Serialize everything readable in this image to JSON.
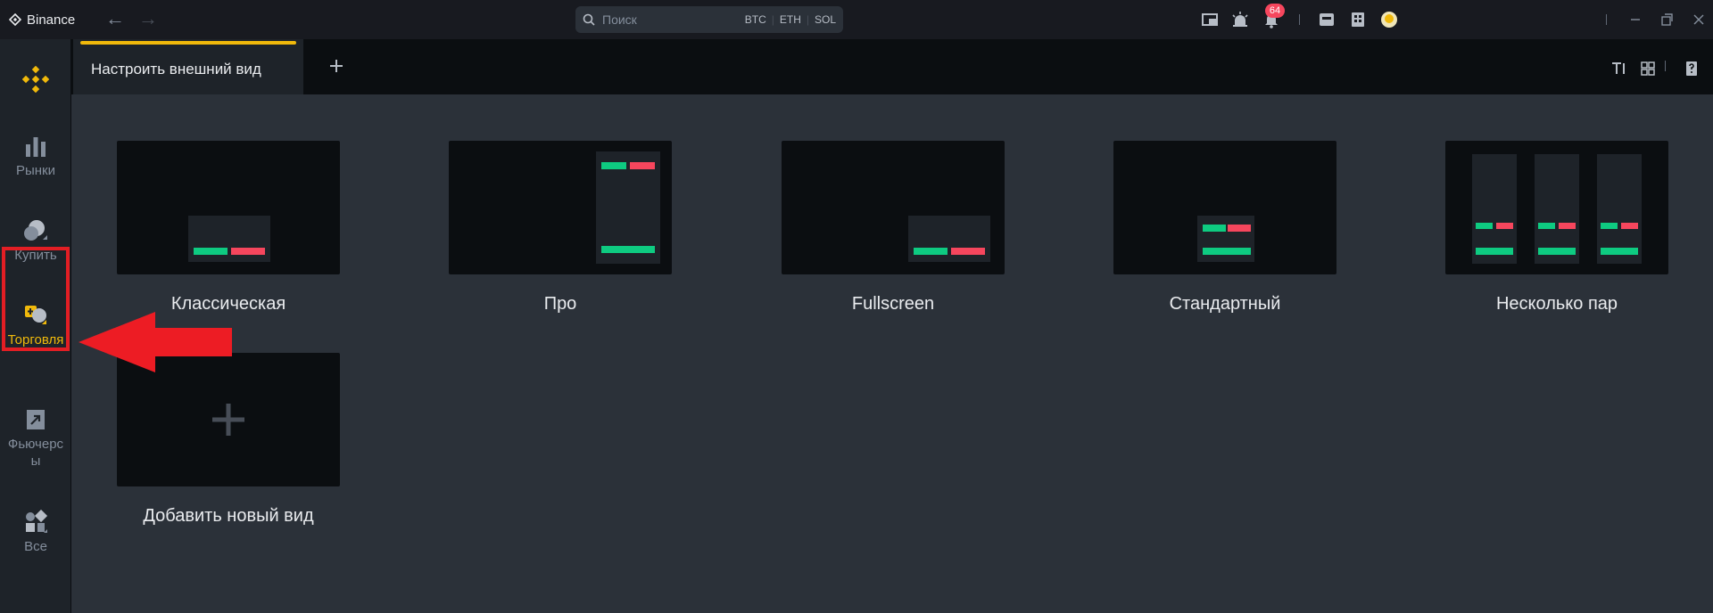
{
  "app": {
    "title": "Binance"
  },
  "search": {
    "placeholder": "Поиск",
    "chips": [
      "BTC",
      "ETH",
      "SOL"
    ]
  },
  "notifications": {
    "count": "64"
  },
  "sidebar": {
    "items": [
      {
        "label": "Рынки",
        "icon": "markets-icon"
      },
      {
        "label": "Купить",
        "icon": "buy-crypto-icon"
      },
      {
        "label": "Торговля",
        "icon": "trade-icon",
        "active": true
      },
      {
        "label": "Фьючерсы",
        "icon": "futures-icon"
      },
      {
        "label": "Все",
        "icon": "all-apps-icon"
      }
    ]
  },
  "tabs": {
    "active_label": "Настроить внешний вид",
    "add_icon": "plus-icon"
  },
  "layouts": [
    {
      "label": "Классическая"
    },
    {
      "label": "Про"
    },
    {
      "label": "Fullscreen"
    },
    {
      "label": "Стандартный"
    },
    {
      "label": "Несколько пар"
    },
    {
      "label": "Добавить новый вид"
    }
  ],
  "colors": {
    "accent": "#f0b90b",
    "buy": "#0ecb81",
    "sell": "#f6465d",
    "highlight": "#e31e24"
  }
}
